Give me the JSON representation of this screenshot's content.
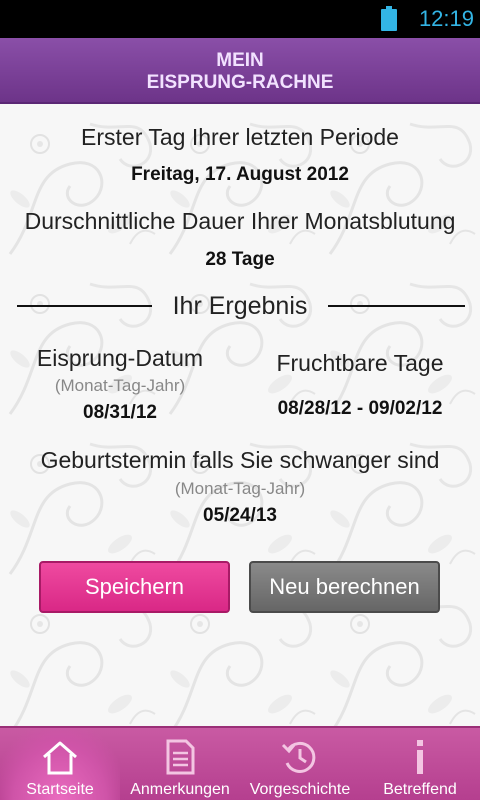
{
  "status_bar": {
    "time": "12:19",
    "battery_icon": "battery-full-icon"
  },
  "header": {
    "title_line1": "MEIN",
    "title_line2": "EISPRUNG-RACHNE"
  },
  "period": {
    "label": "Erster Tag Ihrer letzten Periode",
    "value": "Freitag, 17. August 2012"
  },
  "duration": {
    "label": "Durschnittliche Dauer Ihrer Monatsblutung",
    "value": "28 Tage"
  },
  "result": {
    "heading": "Ihr Ergebnis",
    "ovulation": {
      "label": "Eisprung-Datum",
      "format": "(Monat-Tag-Jahr)",
      "value": "08/31/12"
    },
    "fertile": {
      "label": "Fruchtbare Tage",
      "value": "08/28/12 - 09/02/12"
    },
    "due": {
      "label": "Geburtstermin falls Sie schwanger sind",
      "format": "(Monat-Tag-Jahr)",
      "value": "05/24/13"
    }
  },
  "buttons": {
    "save": "Speichern",
    "recalc": "Neu berechnen"
  },
  "tabs": [
    {
      "label": "Startseite",
      "icon": "home-icon",
      "active": true
    },
    {
      "label": "Anmerkungen",
      "icon": "notes-icon",
      "active": false
    },
    {
      "label": "Vorgeschichte",
      "icon": "history-icon",
      "active": false
    },
    {
      "label": "Betreffend",
      "icon": "info-icon",
      "active": false
    }
  ],
  "colors": {
    "header": "#6d3489",
    "header_text": "#f2e2ff",
    "save_button": "#e0308c",
    "recalc_button": "#777777",
    "tab_bar": "#b53f8f",
    "status_icon": "#33b5e5"
  }
}
